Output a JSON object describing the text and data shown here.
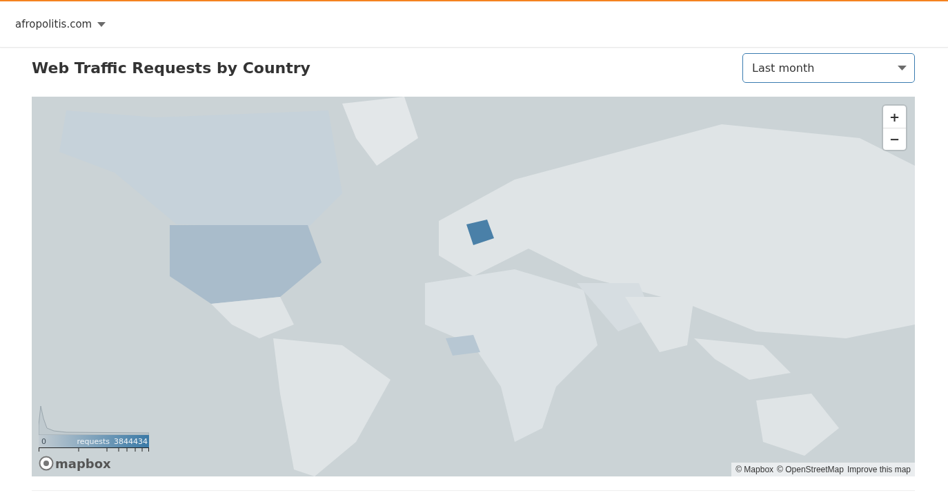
{
  "site_switcher": {
    "label": "afropolitis.com"
  },
  "title": "Web Traffic Requests by Country",
  "period_select": {
    "value": "Last month"
  },
  "map": {
    "kind": "picture",
    "zoom_controls": [
      "+",
      "−"
    ],
    "legend": {
      "min": "0",
      "label": "requests",
      "max": "3844434"
    },
    "logo": "mapbox",
    "attribution": [
      "© Mapbox",
      "© OpenStreetMap",
      "Improve this map"
    ]
  }
}
